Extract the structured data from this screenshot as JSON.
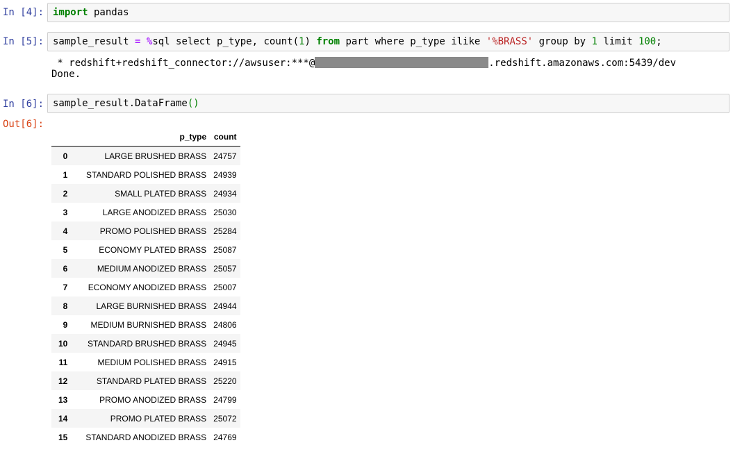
{
  "cells": [
    {
      "prompt": "In [4]:",
      "code": {
        "kw": "import",
        "rest": " pandas"
      }
    },
    {
      "prompt": "In [5]:",
      "code": {
        "var": "sample_result ",
        "eq": "=",
        "magic_pct": " %",
        "sql_a": "sql select p_type, count(",
        "num1": "1",
        "sql_b": ") ",
        "kw_from": "from",
        "sql_c": " part where p_type ilike ",
        "pattern": "'%BRASS'",
        "sql_d": " group by ",
        "num2": "1",
        "sql_e": " limit ",
        "num3": "100",
        "sql_f": ";"
      },
      "output": {
        "conn_prefix": " * redshift+redshift_connector://awsuser:***@",
        "conn_suffix": ".redshift.amazonaws.com:5439/dev",
        "done": "Done."
      }
    },
    {
      "prompt": "In [6]:",
      "code": {
        "pre": "sample_result.DataFrame",
        "parens": "()"
      },
      "out_prompt": "Out[6]:"
    }
  ],
  "dataframe": {
    "columns": [
      "p_type",
      "count"
    ],
    "rows": [
      {
        "idx": "0",
        "p_type": "LARGE BRUSHED BRASS",
        "count": "24757"
      },
      {
        "idx": "1",
        "p_type": "STANDARD POLISHED BRASS",
        "count": "24939"
      },
      {
        "idx": "2",
        "p_type": "SMALL PLATED BRASS",
        "count": "24934"
      },
      {
        "idx": "3",
        "p_type": "LARGE ANODIZED BRASS",
        "count": "25030"
      },
      {
        "idx": "4",
        "p_type": "PROMO POLISHED BRASS",
        "count": "25284"
      },
      {
        "idx": "5",
        "p_type": "ECONOMY PLATED BRASS",
        "count": "25087"
      },
      {
        "idx": "6",
        "p_type": "MEDIUM ANODIZED BRASS",
        "count": "25057"
      },
      {
        "idx": "7",
        "p_type": "ECONOMY ANODIZED BRASS",
        "count": "25007"
      },
      {
        "idx": "8",
        "p_type": "LARGE BURNISHED BRASS",
        "count": "24944"
      },
      {
        "idx": "9",
        "p_type": "MEDIUM BURNISHED BRASS",
        "count": "24806"
      },
      {
        "idx": "10",
        "p_type": "STANDARD BRUSHED BRASS",
        "count": "24945"
      },
      {
        "idx": "11",
        "p_type": "MEDIUM POLISHED BRASS",
        "count": "24915"
      },
      {
        "idx": "12",
        "p_type": "STANDARD PLATED BRASS",
        "count": "25220"
      },
      {
        "idx": "13",
        "p_type": "PROMO ANODIZED BRASS",
        "count": "24799"
      },
      {
        "idx": "14",
        "p_type": "PROMO PLATED BRASS",
        "count": "25072"
      },
      {
        "idx": "15",
        "p_type": "STANDARD ANODIZED BRASS",
        "count": "24769"
      }
    ]
  },
  "colors": {
    "prompt_in": "#303f9f",
    "prompt_out": "#d84315",
    "keyword": "#008000",
    "operator": "#aa22ff",
    "string": "#ba2121",
    "cell_bg": "#f7f7f7"
  }
}
